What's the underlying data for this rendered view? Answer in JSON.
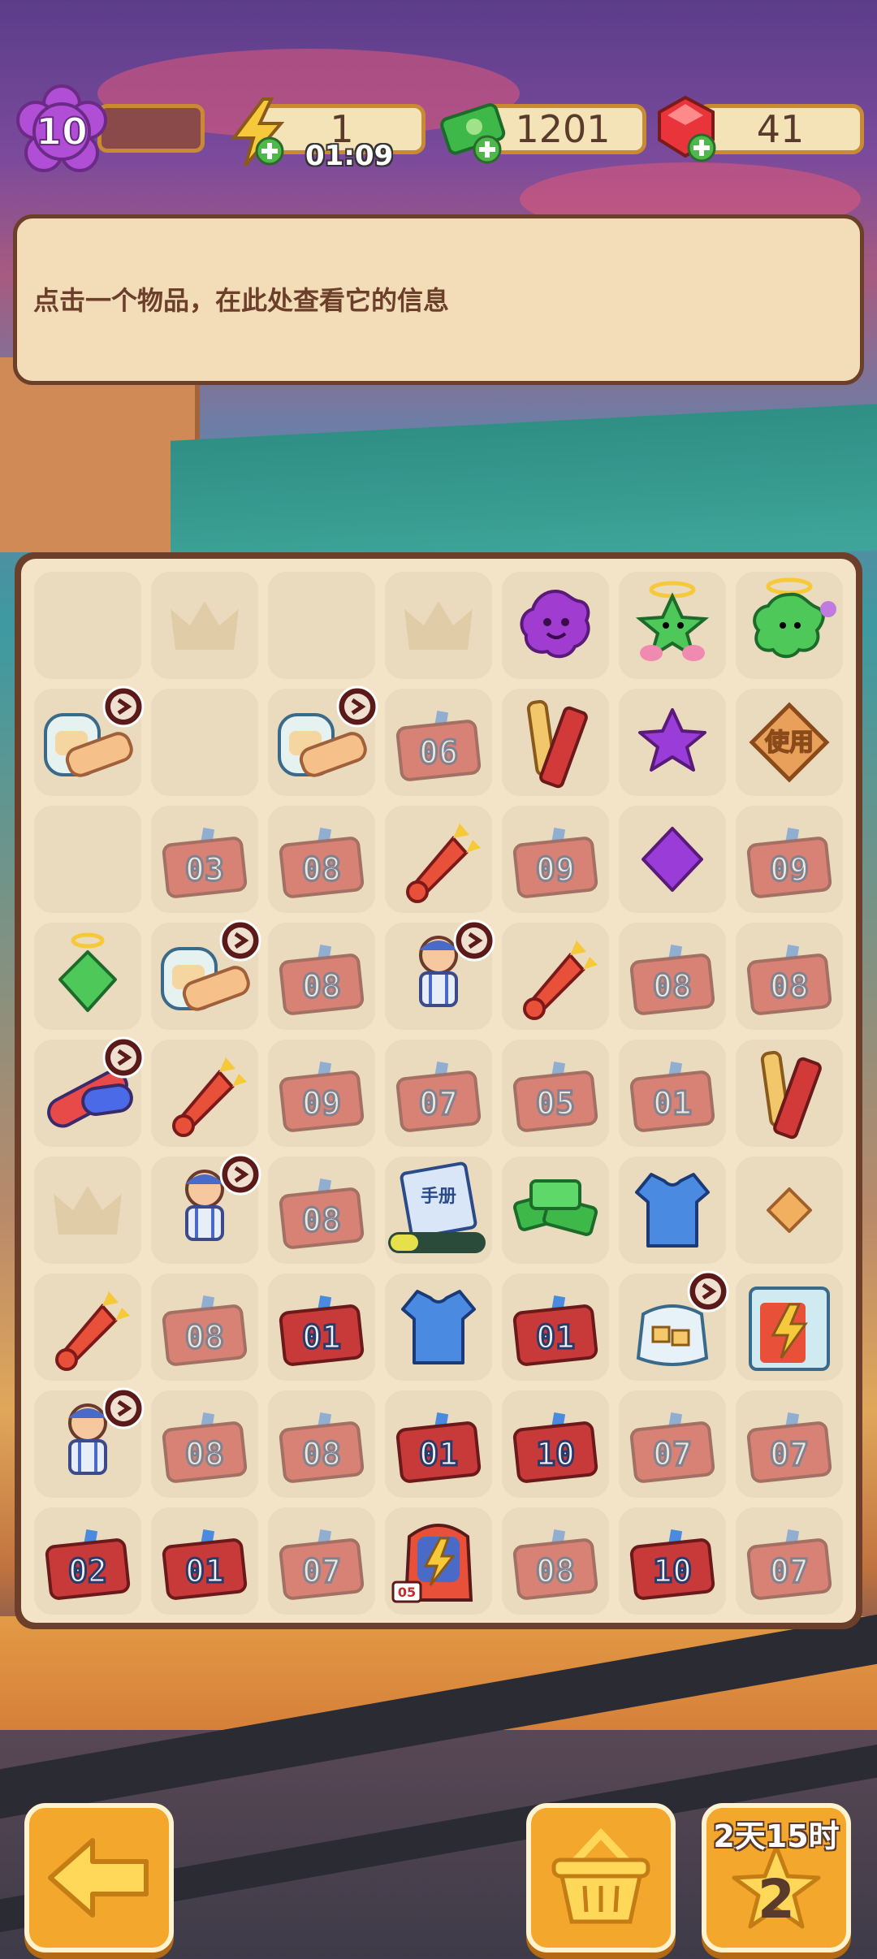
{
  "hud": {
    "level": "10",
    "energy": "1",
    "energy_timer": "01:09",
    "cash": "1201",
    "gems": "41"
  },
  "info_panel": {
    "text": "点击一个物品，在此处查看它的信息"
  },
  "colors": {
    "accent": "#f3a72c",
    "panel": "#f3ddb8",
    "border": "#6b3f2a"
  },
  "board": {
    "rows": [
      [
        {
          "item": "crown-slot-empty"
        },
        {
          "item": "crown-slot"
        },
        {
          "item": "crown-slot-empty"
        },
        {
          "item": "crown-slot"
        },
        {
          "item": "purple-blob"
        },
        {
          "item": "green-angel-star"
        },
        {
          "item": "green-angel-blob"
        }
      ],
      [
        {
          "item": "bandage-jar"
        },
        {
          "item": "empty"
        },
        {
          "item": "bandage-jar"
        },
        {
          "item": "ticket",
          "label": "06",
          "faded": true
        },
        {
          "item": "snack-sticks"
        },
        {
          "item": "purple-star"
        },
        {
          "item": "use-diamond",
          "label": "使用"
        }
      ],
      [
        {
          "item": "empty"
        },
        {
          "item": "ticket",
          "label": "03",
          "faded": true
        },
        {
          "item": "ticket",
          "label": "08",
          "faded": true
        },
        {
          "item": "horn"
        },
        {
          "item": "ticket",
          "label": "09",
          "faded": true
        },
        {
          "item": "purple-diamond"
        },
        {
          "item": "ticket",
          "label": "09",
          "faded": true
        }
      ],
      [
        {
          "item": "green-angel-gem"
        },
        {
          "item": "bandage-jar"
        },
        {
          "item": "ticket",
          "label": "08",
          "faded": true
        },
        {
          "item": "player-figure"
        },
        {
          "item": "horn"
        },
        {
          "item": "ticket",
          "label": "08",
          "faded": true
        },
        {
          "item": "ticket",
          "label": "08",
          "faded": true
        }
      ],
      [
        {
          "item": "pill-capsule"
        },
        {
          "item": "horn"
        },
        {
          "item": "ticket",
          "label": "09",
          "faded": true
        },
        {
          "item": "ticket",
          "label": "07",
          "faded": true
        },
        {
          "item": "ticket",
          "label": "05",
          "faded": true
        },
        {
          "item": "ticket",
          "label": "01",
          "faded": true
        },
        {
          "item": "snack-sticks"
        }
      ],
      [
        {
          "item": "crown-slot"
        },
        {
          "item": "player-figure"
        },
        {
          "item": "ticket",
          "label": "08",
          "faded": true
        },
        {
          "item": "handbook",
          "label": "手册",
          "progress": 0.3
        },
        {
          "item": "cash-pile"
        },
        {
          "item": "jersey"
        },
        {
          "item": "orange-diamond"
        }
      ],
      [
        {
          "item": "horn"
        },
        {
          "item": "ticket",
          "label": "08",
          "faded": true
        },
        {
          "item": "ticket",
          "label": "01"
        },
        {
          "item": "jersey"
        },
        {
          "item": "ticket",
          "label": "01"
        },
        {
          "item": "snack-bag"
        },
        {
          "item": "energy-jar"
        }
      ],
      [
        {
          "item": "player-figure"
        },
        {
          "item": "ticket",
          "label": "08",
          "faded": true
        },
        {
          "item": "ticket",
          "label": "08",
          "faded": true
        },
        {
          "item": "ticket",
          "label": "01"
        },
        {
          "item": "ticket",
          "label": "10"
        },
        {
          "item": "ticket",
          "label": "07",
          "faded": true
        },
        {
          "item": "ticket",
          "label": "07",
          "faded": true
        }
      ],
      [
        {
          "item": "ticket",
          "label": "02"
        },
        {
          "item": "ticket",
          "label": "01"
        },
        {
          "item": "ticket",
          "label": "07",
          "faded": true
        },
        {
          "item": "energy-backpack",
          "label": "05"
        },
        {
          "item": "ticket",
          "label": "08",
          "faded": true
        },
        {
          "item": "ticket",
          "label": "10"
        },
        {
          "item": "ticket",
          "label": "07",
          "faded": true
        }
      ]
    ]
  },
  "bottom": {
    "event_time": "2天15时",
    "event_count": "2"
  }
}
